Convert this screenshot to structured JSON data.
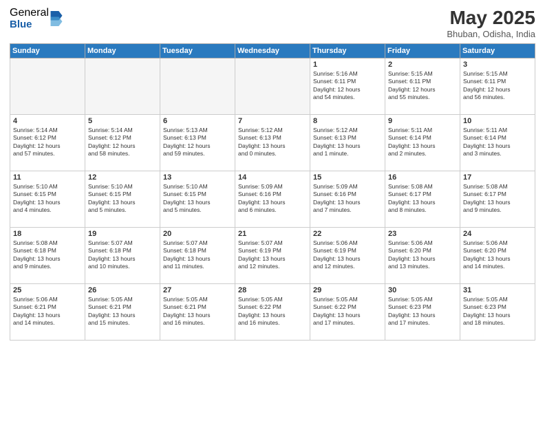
{
  "logo": {
    "general": "General",
    "blue": "Blue"
  },
  "header": {
    "title": "May 2025",
    "subtitle": "Bhuban, Odisha, India"
  },
  "weekdays": [
    "Sunday",
    "Monday",
    "Tuesday",
    "Wednesday",
    "Thursday",
    "Friday",
    "Saturday"
  ],
  "weeks": [
    [
      {
        "day": "",
        "info": ""
      },
      {
        "day": "",
        "info": ""
      },
      {
        "day": "",
        "info": ""
      },
      {
        "day": "",
        "info": ""
      },
      {
        "day": "1",
        "info": "Sunrise: 5:16 AM\nSunset: 6:11 PM\nDaylight: 12 hours\nand 54 minutes."
      },
      {
        "day": "2",
        "info": "Sunrise: 5:15 AM\nSunset: 6:11 PM\nDaylight: 12 hours\nand 55 minutes."
      },
      {
        "day": "3",
        "info": "Sunrise: 5:15 AM\nSunset: 6:11 PM\nDaylight: 12 hours\nand 56 minutes."
      }
    ],
    [
      {
        "day": "4",
        "info": "Sunrise: 5:14 AM\nSunset: 6:12 PM\nDaylight: 12 hours\nand 57 minutes."
      },
      {
        "day": "5",
        "info": "Sunrise: 5:14 AM\nSunset: 6:12 PM\nDaylight: 12 hours\nand 58 minutes."
      },
      {
        "day": "6",
        "info": "Sunrise: 5:13 AM\nSunset: 6:13 PM\nDaylight: 12 hours\nand 59 minutes."
      },
      {
        "day": "7",
        "info": "Sunrise: 5:12 AM\nSunset: 6:13 PM\nDaylight: 13 hours\nand 0 minutes."
      },
      {
        "day": "8",
        "info": "Sunrise: 5:12 AM\nSunset: 6:13 PM\nDaylight: 13 hours\nand 1 minute."
      },
      {
        "day": "9",
        "info": "Sunrise: 5:11 AM\nSunset: 6:14 PM\nDaylight: 13 hours\nand 2 minutes."
      },
      {
        "day": "10",
        "info": "Sunrise: 5:11 AM\nSunset: 6:14 PM\nDaylight: 13 hours\nand 3 minutes."
      }
    ],
    [
      {
        "day": "11",
        "info": "Sunrise: 5:10 AM\nSunset: 6:15 PM\nDaylight: 13 hours\nand 4 minutes."
      },
      {
        "day": "12",
        "info": "Sunrise: 5:10 AM\nSunset: 6:15 PM\nDaylight: 13 hours\nand 5 minutes."
      },
      {
        "day": "13",
        "info": "Sunrise: 5:10 AM\nSunset: 6:15 PM\nDaylight: 13 hours\nand 5 minutes."
      },
      {
        "day": "14",
        "info": "Sunrise: 5:09 AM\nSunset: 6:16 PM\nDaylight: 13 hours\nand 6 minutes."
      },
      {
        "day": "15",
        "info": "Sunrise: 5:09 AM\nSunset: 6:16 PM\nDaylight: 13 hours\nand 7 minutes."
      },
      {
        "day": "16",
        "info": "Sunrise: 5:08 AM\nSunset: 6:17 PM\nDaylight: 13 hours\nand 8 minutes."
      },
      {
        "day": "17",
        "info": "Sunrise: 5:08 AM\nSunset: 6:17 PM\nDaylight: 13 hours\nand 9 minutes."
      }
    ],
    [
      {
        "day": "18",
        "info": "Sunrise: 5:08 AM\nSunset: 6:18 PM\nDaylight: 13 hours\nand 9 minutes."
      },
      {
        "day": "19",
        "info": "Sunrise: 5:07 AM\nSunset: 6:18 PM\nDaylight: 13 hours\nand 10 minutes."
      },
      {
        "day": "20",
        "info": "Sunrise: 5:07 AM\nSunset: 6:18 PM\nDaylight: 13 hours\nand 11 minutes."
      },
      {
        "day": "21",
        "info": "Sunrise: 5:07 AM\nSunset: 6:19 PM\nDaylight: 13 hours\nand 12 minutes."
      },
      {
        "day": "22",
        "info": "Sunrise: 5:06 AM\nSunset: 6:19 PM\nDaylight: 13 hours\nand 12 minutes."
      },
      {
        "day": "23",
        "info": "Sunrise: 5:06 AM\nSunset: 6:20 PM\nDaylight: 13 hours\nand 13 minutes."
      },
      {
        "day": "24",
        "info": "Sunrise: 5:06 AM\nSunset: 6:20 PM\nDaylight: 13 hours\nand 14 minutes."
      }
    ],
    [
      {
        "day": "25",
        "info": "Sunrise: 5:06 AM\nSunset: 6:21 PM\nDaylight: 13 hours\nand 14 minutes."
      },
      {
        "day": "26",
        "info": "Sunrise: 5:05 AM\nSunset: 6:21 PM\nDaylight: 13 hours\nand 15 minutes."
      },
      {
        "day": "27",
        "info": "Sunrise: 5:05 AM\nSunset: 6:21 PM\nDaylight: 13 hours\nand 16 minutes."
      },
      {
        "day": "28",
        "info": "Sunrise: 5:05 AM\nSunset: 6:22 PM\nDaylight: 13 hours\nand 16 minutes."
      },
      {
        "day": "29",
        "info": "Sunrise: 5:05 AM\nSunset: 6:22 PM\nDaylight: 13 hours\nand 17 minutes."
      },
      {
        "day": "30",
        "info": "Sunrise: 5:05 AM\nSunset: 6:23 PM\nDaylight: 13 hours\nand 17 minutes."
      },
      {
        "day": "31",
        "info": "Sunrise: 5:05 AM\nSunset: 6:23 PM\nDaylight: 13 hours\nand 18 minutes."
      }
    ]
  ]
}
